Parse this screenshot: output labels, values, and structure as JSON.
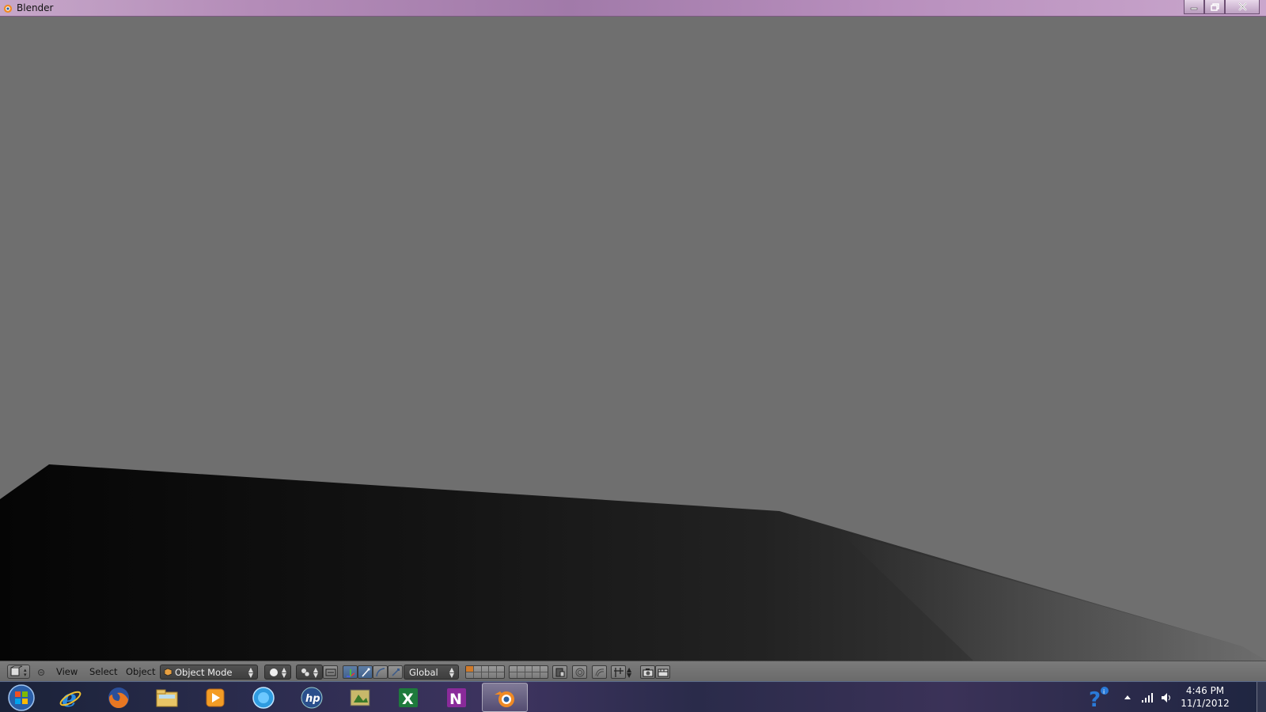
{
  "window": {
    "title": "Blender",
    "controls": [
      "minimize-icon",
      "restore-icon",
      "close-icon"
    ]
  },
  "viewport": {
    "background_color": "#6f6f6f",
    "object_color": "#111111"
  },
  "header": {
    "menus": [
      "View",
      "Select",
      "Object"
    ],
    "mode_dropdown": "Object Mode",
    "orientation_dropdown": "Global",
    "icons": [
      "editor-type-icon",
      "collapse-icon",
      "object-mode-icon",
      "viewport-shading-icon",
      "pivot-point-icon",
      "manipulator-toggle-icon",
      "translate-icon",
      "rotate-icon",
      "scale-icon",
      "layers-grid",
      "layers-grid-2",
      "lock-layers-icon",
      "proportional-edit-icon",
      "snap-icon",
      "snap-element-icon",
      "render-icon",
      "render-animation-icon"
    ]
  },
  "taskbar": {
    "apps": [
      "internet-explorer-icon",
      "firefox-icon",
      "file-explorer-icon",
      "media-player-icon",
      "browser-globe-icon",
      "hp-icon",
      "image-viewer-icon",
      "excel-icon",
      "onenote-icon",
      "blender-icon"
    ],
    "active_app": "blender-icon",
    "time": "4:46 PM",
    "date": "11/1/2012"
  }
}
